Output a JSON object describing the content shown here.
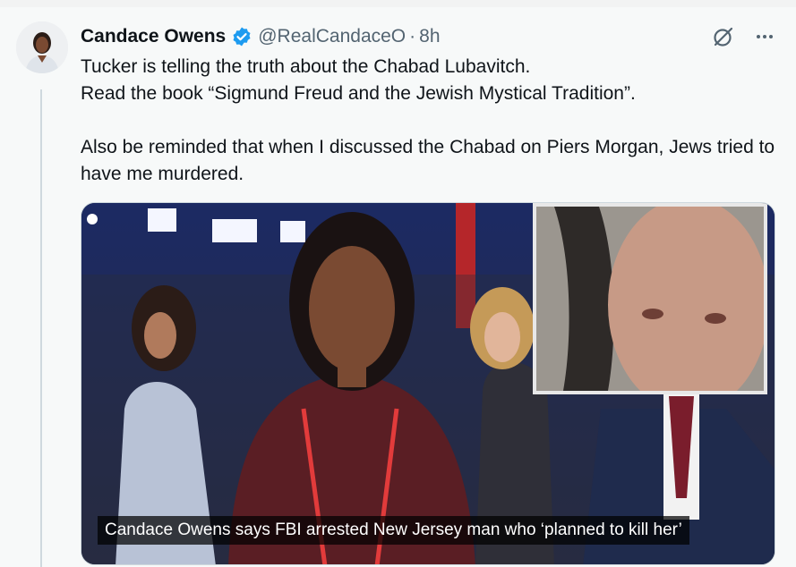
{
  "tweet": {
    "author_name": "Candace Owens",
    "handle": "@RealCandaceO",
    "separator": "·",
    "timestamp": "8h",
    "verified_icon": "verified-badge-icon",
    "text": "Tucker is telling the truth about the Chabad Lubavitch.\nRead the book “Sigmund Freud and the Jewish Mystical Tradition”.\n\nAlso be reminded that when I discussed the Chabad on Piers Morgan, Jews tried to have me murdered.",
    "actions": [
      "grok-icon",
      "more-icon"
    ]
  },
  "media": {
    "caption": "Candace Owens says FBI arrested New Jersey man who ‘planned to kill her’"
  },
  "colors": {
    "verified_blue": "#1d9bf0",
    "secondary_text": "#536471",
    "thread_line": "#cfd9de"
  }
}
